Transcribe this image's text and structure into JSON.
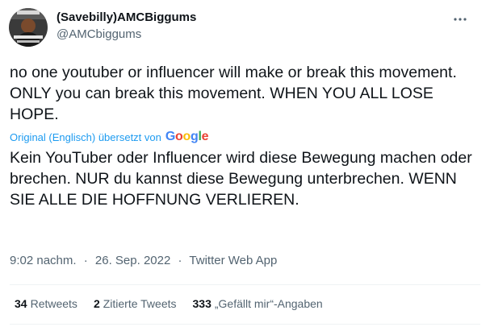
{
  "author": {
    "display_name": "(Savebilly)AMCBiggums",
    "handle": "@AMCbiggums"
  },
  "tweet": {
    "original_text": "no one youtuber or influencer will make or break this movement. ONLY you can break this movement. WHEN YOU ALL LOSE HOPE.",
    "translation_label": "Original (Englisch) übersetzt von",
    "translation_provider": "Google",
    "translated_text": "Kein YouTuber oder Influencer wird diese Bewegung machen oder brechen. NUR du kannst diese Bewegung unterbrechen. WENN SIE ALLE DIE HOFFNUNG VERLIEREN."
  },
  "meta": {
    "time": "9:02 nachm.",
    "separator": "·",
    "date": "26. Sep. 2022",
    "source": "Twitter Web App"
  },
  "stats": {
    "retweets_count": "34",
    "retweets_label": "Retweets",
    "quotes_count": "2",
    "quotes_label": "Zitierte Tweets",
    "likes_count": "333",
    "likes_label": "„Gefällt mir“-Angaben"
  },
  "icons": {
    "more": "more-horizontal-icon",
    "avatar": "avatar-image"
  },
  "colors": {
    "text_primary": "#0f1419",
    "text_secondary": "#536471",
    "link_blue": "#1d9bf0",
    "divider": "#eff3f4",
    "google_blue": "#4285f4",
    "google_red": "#ea4335",
    "google_yellow": "#fbbc05",
    "google_green": "#34a853"
  }
}
